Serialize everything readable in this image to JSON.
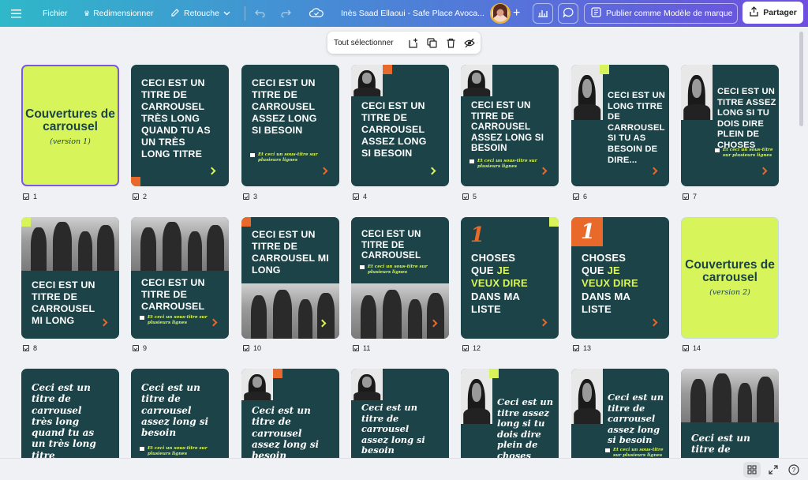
{
  "topbar": {
    "menu_icon": "hamburger-icon",
    "file": "Fichier",
    "resize": "Redimensionner",
    "edit": "Retouche",
    "doc_title": "Inès Saad Ellaoui - Safe Place Avoca...",
    "publish": "Publier comme Modèle de marque",
    "share": "Partager"
  },
  "selection_bar": {
    "select_all": "Tout sélectionner"
  },
  "pages": {
    "p1": {
      "number": "1",
      "title": "Couvertures de carrousel",
      "subtitle": "(version 1)"
    },
    "p2": {
      "number": "2",
      "title": "CECI EST UN TITRE DE CARROUSEL TRÈS LONG QUAND TU AS UN TRÈS LONG TITRE"
    },
    "p3": {
      "number": "3",
      "title": "CECI EST UN TITRE DE CARROUSEL ASSEZ LONG SI BESOIN",
      "subtitle": "Et ceci un sous-titre sur plusieurs lignes"
    },
    "p4": {
      "number": "4",
      "title": "CECI EST UN TITRE DE CARROUSEL ASSEZ LONG SI BESOIN"
    },
    "p5": {
      "number": "5",
      "title": "CECI EST UN TITRE DE CARROUSEL ASSEZ LONG SI BESOIN",
      "subtitle": "Et ceci un sous-titre sur plusieurs lignes"
    },
    "p6": {
      "number": "6",
      "title": "CECI EST UN LONG TITRE DE CARROUSEL SI TU AS BESOIN DE DIRE..."
    },
    "p7": {
      "number": "7",
      "title": "CECI EST UN TITRE ASSEZ LONG SI TU DOIS DIRE PLEIN DE CHOSES",
      "subtitle": "Et ceci un sous-titre sur plusieurs lignes"
    },
    "p8": {
      "number": "8",
      "title": "CECI EST UN TITRE DE CARROUSEL MI LONG"
    },
    "p9": {
      "number": "9",
      "title": "CECI EST UN TITRE DE CARROUSEL",
      "subtitle": "Et ceci un sous-titre sur plusieurs lignes"
    },
    "p10": {
      "number": "10",
      "title": "CECI EST UN TITRE DE CARROUSEL MI LONG"
    },
    "p11": {
      "number": "11",
      "title": "CECI EST UN TITRE DE CARROUSEL",
      "subtitle": "Et ceci un sous-titre sur plusieurs lignes"
    },
    "p12": {
      "number": "12",
      "big": "1",
      "line1": "CHOSES",
      "line2a": "QUE ",
      "line2b": "JE",
      "line3": "VEUX DIRE",
      "line4": "DANS MA",
      "line5": "LISTE"
    },
    "p13": {
      "number": "13",
      "big": "1",
      "line1": "CHOSES",
      "line2a": "QUE ",
      "line2b": "JE",
      "line3": "VEUX DIRE",
      "line4": "DANS MA",
      "line5": "LISTE"
    },
    "p14": {
      "number": "14",
      "title": "Couvertures de carrousel",
      "subtitle": "(version 2)"
    },
    "p15": {
      "title": "Ceci est un titre de carrousel très long quand tu as un très long titre"
    },
    "p16": {
      "title": "Ceci est un titre de carrousel assez long si besoin",
      "subtitle": "Et ceci un sous-titre sur plusieurs lignes"
    },
    "p17": {
      "title": "Ceci est un titre de carrousel assez long si besoin"
    },
    "p18": {
      "title": "Ceci est un titre de carrousel assez long si besoin"
    },
    "p19": {
      "title": "Ceci est un titre assez long si tu dois dire plein de choses"
    },
    "p20": {
      "title": "Ceci est un titre de carrousel assez long si besoin",
      "subtitle": "Et ceci un sous-titre sur plusieurs lignes"
    },
    "p21": {
      "title": "Ceci est un titre de"
    }
  },
  "colors": {
    "teal": "#1b4348",
    "lime": "#d7f55b",
    "orange": "#e9692a",
    "accent": "#7b57e4"
  }
}
